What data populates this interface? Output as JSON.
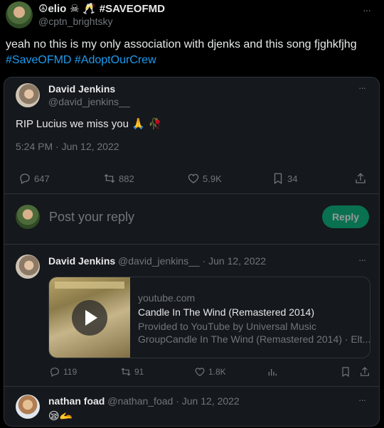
{
  "outer": {
    "display_name": "elio",
    "name_suffix": "#SAVEOFMD",
    "handle": "@cptn_brightsky",
    "text": "yeah no this is my only association with djenks and this song fjghkfjhg",
    "hashtags": "#SaveOFMD #AdoptOurCrew",
    "more": "···"
  },
  "quoted": {
    "name": "David Jenkins",
    "handle": "@david_jenkins__",
    "text": "RIP Lucius we miss you",
    "text_emoji": "🙏 🥀",
    "timestamp": "5:24 PM · Jun 12, 2022",
    "more": "···",
    "metrics": {
      "replies": "647",
      "retweets": "882",
      "likes": "5.9K",
      "bookmarks": "34"
    }
  },
  "reply_box": {
    "placeholder": "Post your reply",
    "button": "Reply"
  },
  "reply1": {
    "name": "David Jenkins",
    "handle": "@david_jenkins__",
    "date": "· Jun 12, 2022",
    "more": "···",
    "link": {
      "domain": "youtube.com",
      "title": "Candle In The Wind (Remastered 2014)",
      "desc_line1": "Provided to YouTube by Universal Music",
      "desc_line2": "GroupCandle In The Wind (Remastered 2014) · Elt..."
    },
    "metrics": {
      "replies": "119",
      "retweets": "91",
      "likes": "1.8K"
    }
  },
  "reply2": {
    "name": "nathan foad",
    "handle": "@nathan_foad",
    "date": "· Jun 12, 2022",
    "more": "···",
    "text_emoji": "😪🫴"
  },
  "colors": {
    "background": "#000000",
    "card": "#15181c",
    "accent": "#1d9bf0",
    "reply_button": "#00ba7c",
    "muted": "#71767b"
  }
}
